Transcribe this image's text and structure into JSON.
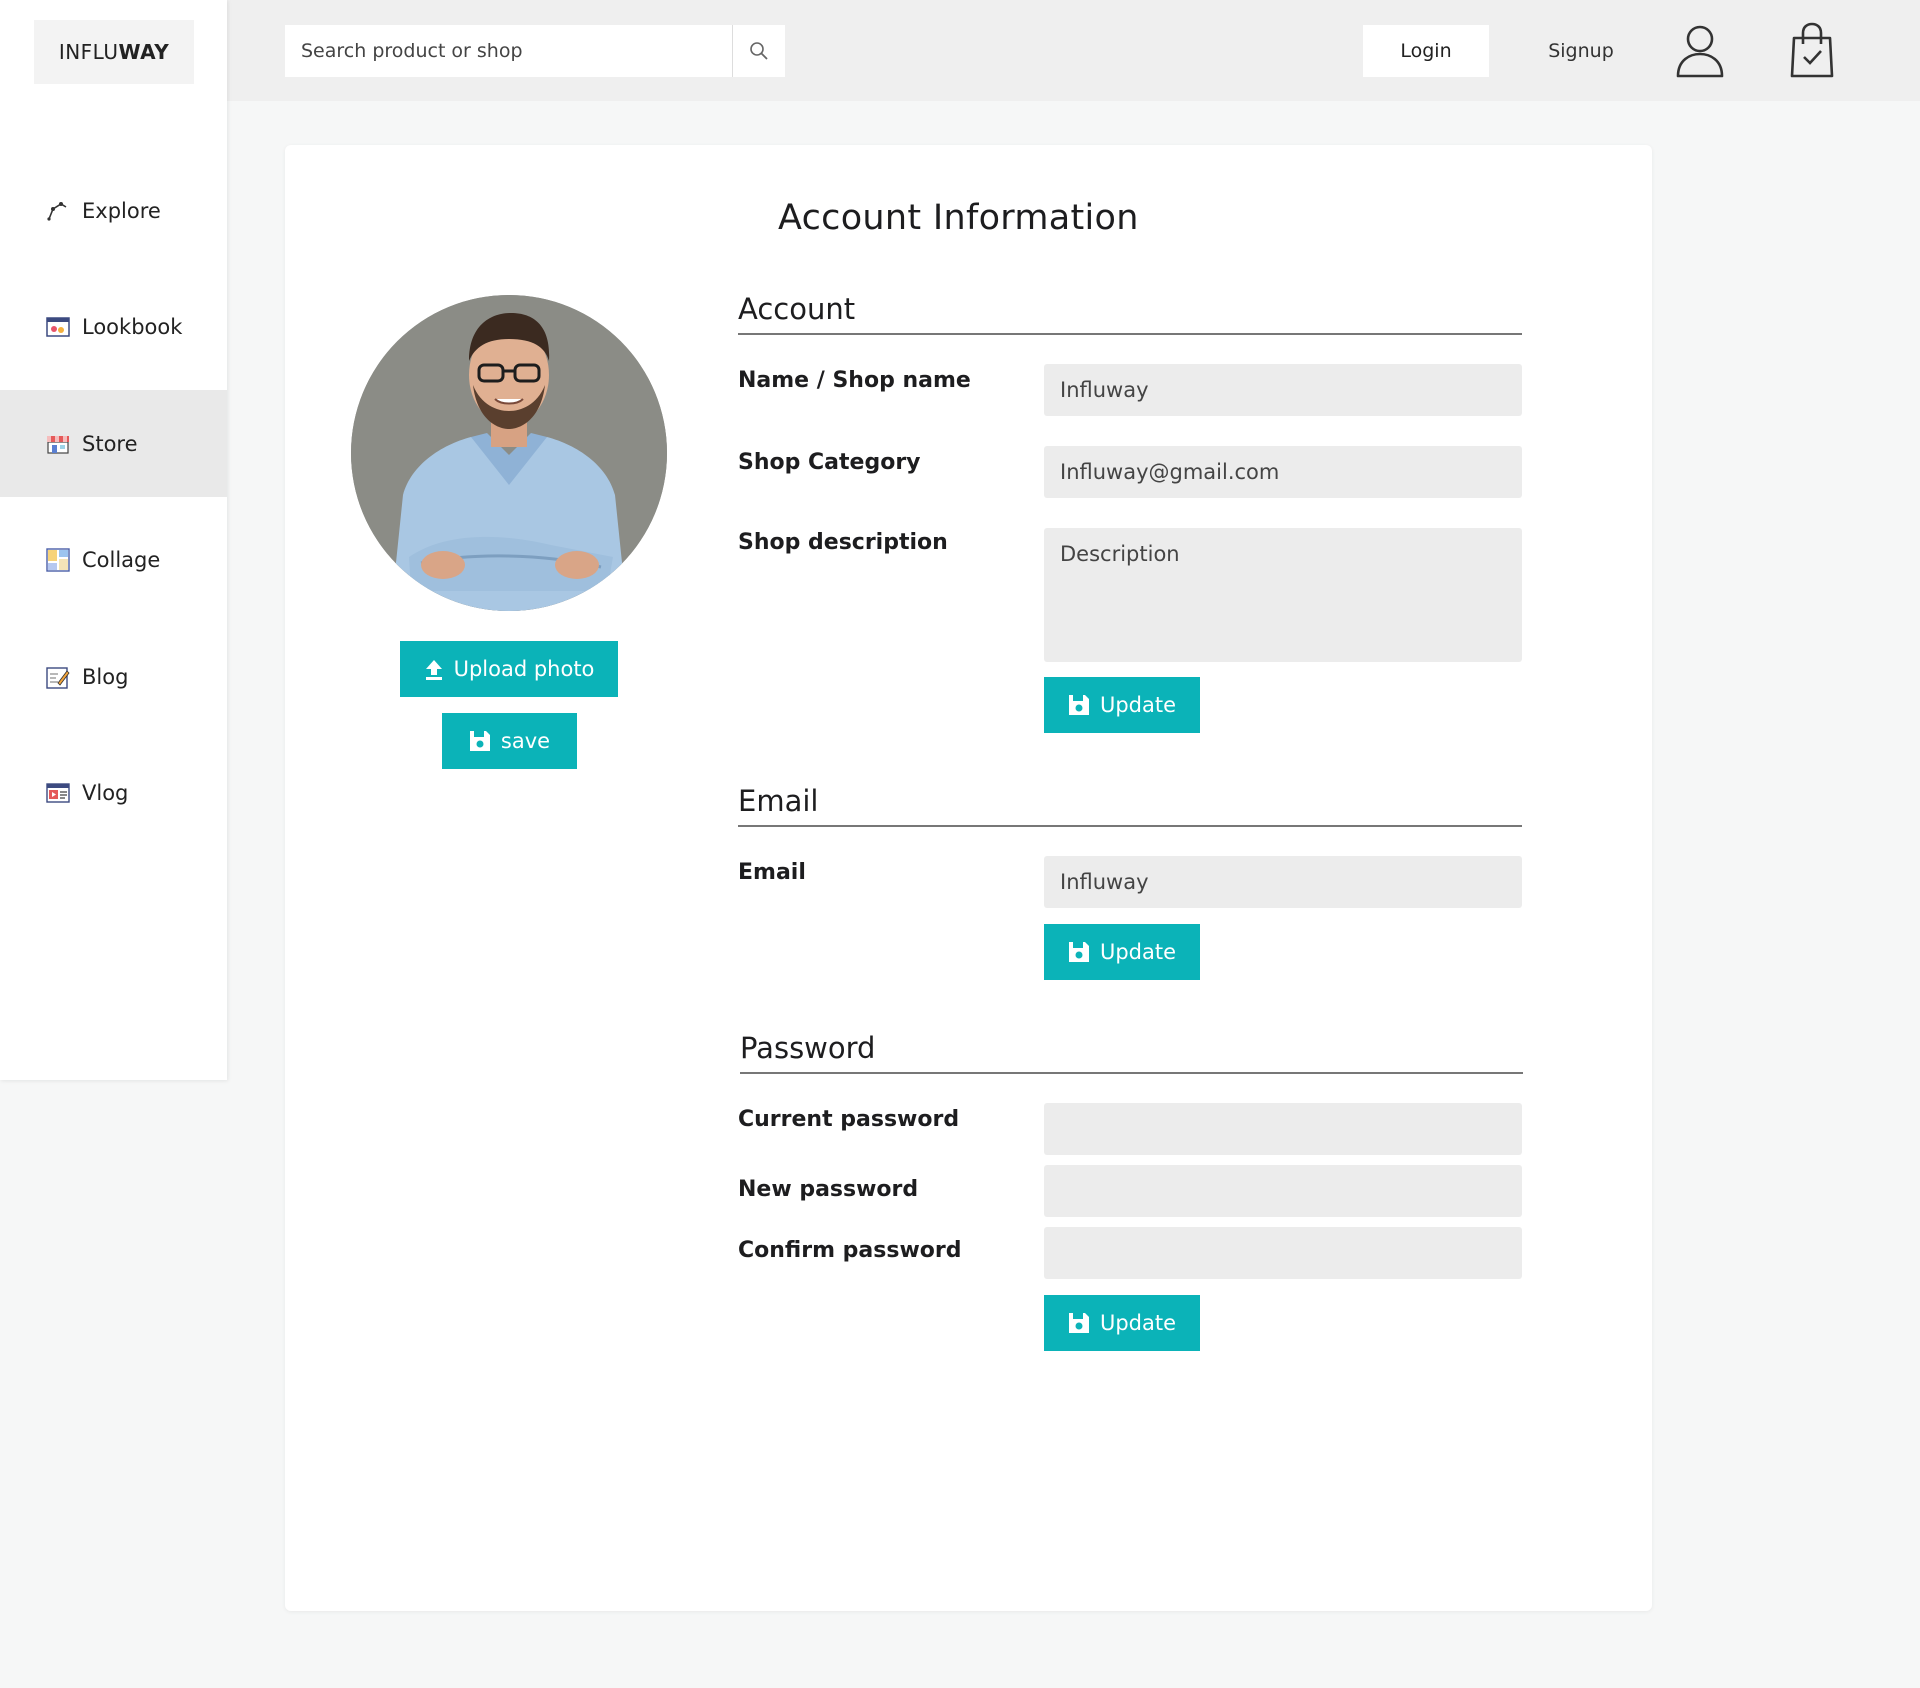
{
  "brand": {
    "logo_light": "INFLU",
    "logo_bold": "WAY"
  },
  "header": {
    "search_placeholder": "Search product or shop",
    "search_icon": "search-icon",
    "login_label": "Login",
    "signup_label": "Signup",
    "user_icon": "user-icon",
    "bag_icon": "shopping-bag-icon"
  },
  "sidebar": {
    "items": [
      {
        "label": "Explore",
        "icon": "explore-icon",
        "active": false
      },
      {
        "label": "Lookbook",
        "icon": "lookbook-icon",
        "active": false
      },
      {
        "label": "Store",
        "icon": "store-icon",
        "active": true
      },
      {
        "label": "Collage",
        "icon": "collage-icon",
        "active": false
      },
      {
        "label": "Blog",
        "icon": "blog-icon",
        "active": false
      },
      {
        "label": "Vlog",
        "icon": "vlog-icon",
        "active": false
      }
    ]
  },
  "main": {
    "title": "Account Information",
    "profile": {
      "upload_label": "Upload photo",
      "save_label": "save"
    },
    "account": {
      "heading": "Account",
      "name_label": "Name / Shop name",
      "name_value": "Influway",
      "category_label": "Shop Category",
      "category_value": "Influway@gmail.com",
      "description_label": "Shop description",
      "description_placeholder": "Description",
      "update_label": "Update"
    },
    "email": {
      "heading": "Email",
      "email_label": "Email",
      "email_value": "Influway",
      "update_label": "Update"
    },
    "password": {
      "heading": "Password",
      "current_label": "Current password",
      "new_label": "New password",
      "confirm_label": "Confirm password",
      "update_label": "Update"
    }
  },
  "colors": {
    "accent": "#0bb3b8",
    "topbar": "#efefef",
    "field": "#ececec",
    "active_nav": "#e9e9e9"
  }
}
